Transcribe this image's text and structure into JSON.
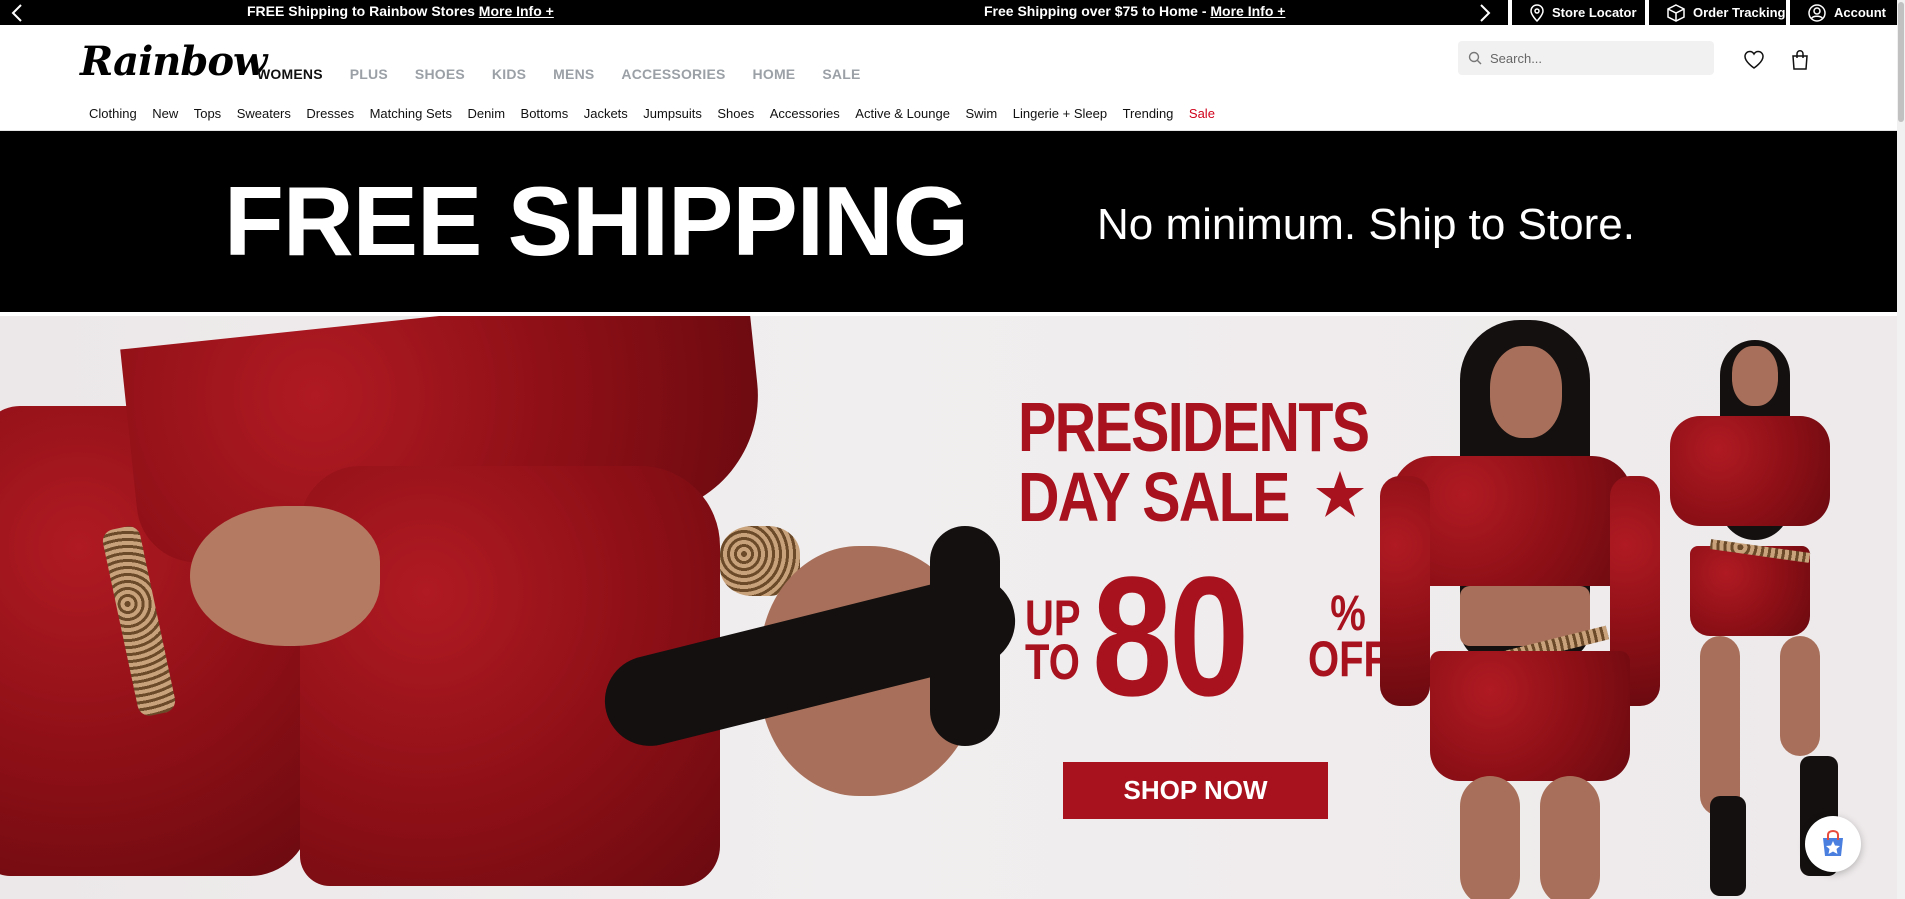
{
  "promo": {
    "message_1": "FREE Shipping to Rainbow Stores ",
    "message_1_link": "More Info +",
    "message_2": "Free Shipping over $75 to Home - ",
    "message_2_link": "More Info +"
  },
  "utility": {
    "store_locator": "Store Locator",
    "order_tracking": "Order Tracking",
    "account": "Account"
  },
  "header": {
    "logo": "Rainbow",
    "search_placeholder": "Search...",
    "departments": [
      {
        "label": "WOMENS",
        "active": true
      },
      {
        "label": "PLUS"
      },
      {
        "label": "SHOES"
      },
      {
        "label": "KIDS"
      },
      {
        "label": "MENS"
      },
      {
        "label": "ACCESSORIES"
      },
      {
        "label": "HOME"
      },
      {
        "label": "SALE"
      }
    ],
    "categories": [
      "Clothing",
      "New",
      "Tops",
      "Sweaters",
      "Dresses",
      "Matching Sets",
      "Denim",
      "Bottoms",
      "Jackets",
      "Jumpsuits",
      "Shoes",
      "Accessories",
      "Active & Lounge",
      "Swim",
      "Lingerie + Sleep",
      "Trending",
      "Sale"
    ]
  },
  "shipping_banner": {
    "headline": "FREE SHIPPING",
    "subline": "No minimum. Ship to Store."
  },
  "hero": {
    "title_line_1": "PRESIDENTS",
    "title_line_2": "DAY SALE",
    "up": "UP",
    "to": "TO",
    "amount": "80",
    "percent": "%",
    "off": "OFF",
    "cta": "SHOP NOW"
  },
  "colors": {
    "brand_red": "#a8121e",
    "sale_red": "#d0021b",
    "promo_bg": "#000000"
  },
  "icons": [
    "chevron-left-icon",
    "chevron-right-icon",
    "location-pin-icon",
    "box-icon",
    "user-icon",
    "search-icon",
    "heart-icon",
    "shopping-bag-icon",
    "star-icon",
    "shopping-app-icon"
  ]
}
